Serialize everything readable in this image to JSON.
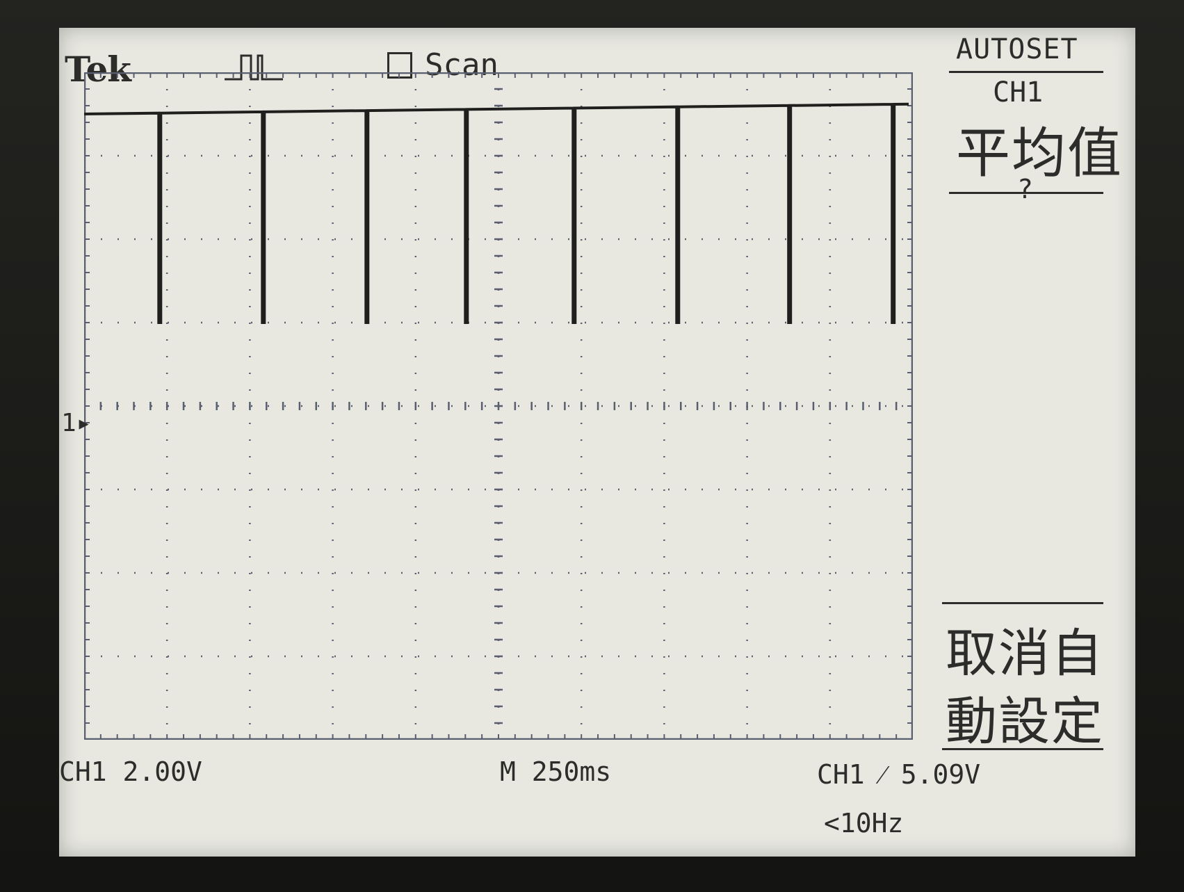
{
  "header": {
    "brand": "Tek",
    "acquire_mode_icon": "pulse-acquire-icon",
    "scan_label": "Scan"
  },
  "side_menu": {
    "title": "AUTOSET",
    "channel": "CH1",
    "measurement": "平均值",
    "measurement_value": "?",
    "cancel_line1": "取消自",
    "cancel_line2": "動設定"
  },
  "markers": {
    "channel_ground": "1"
  },
  "readouts": {
    "channel_scale": "CH1  2.00V",
    "timebase": "M 250ms",
    "trigger": "CH1 ⁄ 5.09V",
    "frequency": "<10Hz"
  },
  "colors": {
    "screen_bg": "#e8e8e1",
    "trace": "#1f1f1d",
    "grid": "#5a5f70",
    "text": "#2c2c2a"
  },
  "chart_data": {
    "type": "line",
    "grid": true,
    "divisions": {
      "horizontal": 10,
      "vertical": 8
    },
    "ylim": [
      -5,
      3
    ],
    "high_level_div": 2.5,
    "low_level_div": 0,
    "pulse_low_divs": [
      0.9,
      2.15,
      3.4,
      4.6,
      5.9,
      7.15,
      8.5,
      9.75
    ],
    "high_drift_div": 0.12
  }
}
